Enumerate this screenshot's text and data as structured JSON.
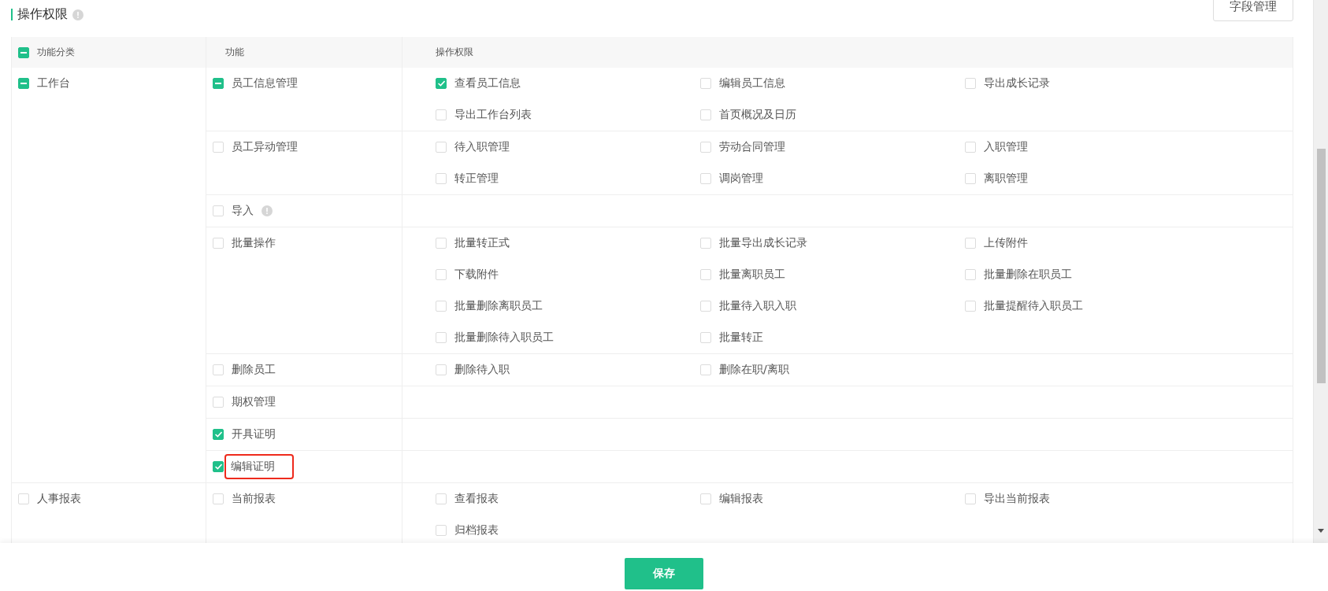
{
  "section": {
    "title": "操作权限",
    "title_hint": true,
    "field_button": "字段管理"
  },
  "table": {
    "columns": [
      {
        "label": "功能分类",
        "checked": false,
        "indeterminate": true
      },
      {
        "label": "功能"
      },
      {
        "label": "操作权限"
      }
    ],
    "categories": [
      {
        "label": "工作台",
        "checked": false,
        "indeterminate": true,
        "functions": [
          {
            "label": "员工信息管理",
            "checked": false,
            "indeterminate": true,
            "hint": false,
            "highlighted": false,
            "permissions": [
              {
                "label": "查看员工信息",
                "checked": true
              },
              {
                "label": "编辑员工信息",
                "checked": false
              },
              {
                "label": "导出成长记录",
                "checked": false
              },
              {
                "label": "导出工作台列表",
                "checked": false
              },
              {
                "label": "首页概况及日历",
                "checked": false
              }
            ]
          },
          {
            "label": "员工异动管理",
            "checked": false,
            "indeterminate": false,
            "hint": false,
            "highlighted": false,
            "permissions": [
              {
                "label": "待入职管理",
                "checked": false
              },
              {
                "label": "劳动合同管理",
                "checked": false
              },
              {
                "label": "入职管理",
                "checked": false
              },
              {
                "label": "转正管理",
                "checked": false
              },
              {
                "label": "调岗管理",
                "checked": false
              },
              {
                "label": "离职管理",
                "checked": false
              }
            ]
          },
          {
            "label": "导入",
            "checked": false,
            "indeterminate": false,
            "hint": true,
            "highlighted": false
          },
          {
            "label": "批量操作",
            "checked": false,
            "indeterminate": false,
            "hint": false,
            "highlighted": false,
            "permissions": [
              {
                "label": "批量转正式",
                "checked": false
              },
              {
                "label": "批量导出成长记录",
                "checked": false
              },
              {
                "label": "上传附件",
                "checked": false
              },
              {
                "label": "下载附件",
                "checked": false
              },
              {
                "label": "批量离职员工",
                "checked": false
              },
              {
                "label": "批量删除在职员工",
                "checked": false
              },
              {
                "label": "批量删除离职员工",
                "checked": false
              },
              {
                "label": "批量待入职入职",
                "checked": false
              },
              {
                "label": "批量提醒待入职员工",
                "checked": false
              },
              {
                "label": "批量删除待入职员工",
                "checked": false
              },
              {
                "label": "批量转正",
                "checked": false
              }
            ]
          },
          {
            "label": "删除员工",
            "checked": false,
            "indeterminate": false,
            "hint": false,
            "highlighted": false,
            "permissions": [
              {
                "label": "删除待入职",
                "checked": false
              },
              {
                "label": "删除在职/离职",
                "checked": false
              }
            ]
          },
          {
            "label": "期权管理",
            "checked": false,
            "indeterminate": false,
            "hint": false,
            "highlighted": false
          },
          {
            "label": "开具证明",
            "checked": true,
            "indeterminate": false,
            "hint": false,
            "highlighted": false
          },
          {
            "label": "编辑证明",
            "checked": true,
            "indeterminate": false,
            "hint": false,
            "highlighted": true
          }
        ]
      },
      {
        "label": "人事报表",
        "checked": false,
        "indeterminate": false,
        "functions": [
          {
            "label": "当前报表",
            "checked": false,
            "indeterminate": false,
            "hint": false,
            "highlighted": false,
            "permissions": [
              {
                "label": "查看报表",
                "checked": false
              },
              {
                "label": "编辑报表",
                "checked": false
              },
              {
                "label": "导出当前报表",
                "checked": false
              },
              {
                "label": "归档报表",
                "checked": false
              }
            ]
          }
        ]
      }
    ]
  },
  "save_button": "保存"
}
